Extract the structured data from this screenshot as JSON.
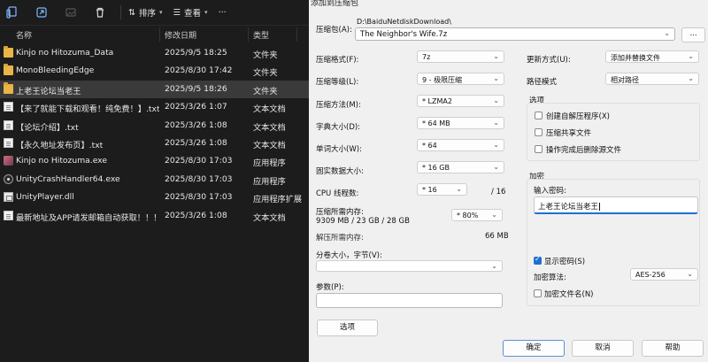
{
  "explorer": {
    "toolbar": {
      "sort_label": "排序",
      "view_label": "查看",
      "more_label": "···"
    },
    "columns": {
      "name": "名称",
      "date": "修改日期",
      "type": "类型"
    },
    "files": [
      {
        "name": "Kinjo no Hitozuma_Data",
        "date": "2025/9/5 18:25",
        "type": "文件夹",
        "icon": "folder-icon"
      },
      {
        "name": "MonoBleedingEdge",
        "date": "2025/8/30 17:42",
        "type": "文件夹",
        "icon": "folder-icon"
      },
      {
        "name": "上老王论坛当老王",
        "date": "2025/9/5 18:26",
        "type": "文件夹",
        "icon": "folder-icon"
      },
      {
        "name": "【来了就能下载和观看！纯免费！】.txt",
        "date": "2025/3/26 1:07",
        "type": "文本文档",
        "icon": "text-file-icon"
      },
      {
        "name": "【论坛介绍】.txt",
        "date": "2025/3/26 1:08",
        "type": "文本文档",
        "icon": "text-file-icon"
      },
      {
        "name": "【永久地址发布页】.txt",
        "date": "2025/3/26 1:08",
        "type": "文本文档",
        "icon": "text-file-icon"
      },
      {
        "name": "Kinjo no Hitozuma.exe",
        "date": "2025/8/30 17:03",
        "type": "应用程序",
        "icon": "app-icon"
      },
      {
        "name": "UnityCrashHandler64.exe",
        "date": "2025/8/30 17:03",
        "type": "应用程序",
        "icon": "unity-icon"
      },
      {
        "name": "UnityPlayer.dll",
        "date": "2025/8/30 17:03",
        "type": "应用程序扩展",
        "icon": "dll-icon"
      },
      {
        "name": "最新地址及APP请发邮箱自动获取！！！...",
        "date": "2025/3/26 1:08",
        "type": "文本文档",
        "icon": "text-file-icon"
      }
    ]
  },
  "dialog": {
    "title": "添加到压缩包",
    "archive_label": "压缩包(A):",
    "archive_path": "D:\\BaiduNetdiskDownload\\",
    "archive_name": "The Neighbor's Wife.7z",
    "browse_label": "...",
    "format_label": "压缩格式(F):",
    "format_value": "7z",
    "level_label": "压缩等级(L):",
    "level_value": "9 - 极限压缩",
    "method_label": "压缩方法(M):",
    "method_value": "* LZMA2",
    "dict_label": "字典大小(D):",
    "dict_value": "* 64 MB",
    "word_label": "单词大小(W):",
    "word_value": "* 64",
    "solid_label": "固实数据大小:",
    "solid_value": "* 16 GB",
    "threads_label": "CPU 线程数:",
    "threads_value": "* 16",
    "threads_total": "/ 16",
    "mem_comp_label": "压缩所需内存:",
    "mem_comp_value": "9309 MB / 23 GB / 28 GB",
    "mem_percent": "* 80%",
    "mem_decomp_label": "解压所需内存:",
    "mem_decomp_value": "66 MB",
    "split_label": "分卷大小，字节(V):",
    "params_label": "参数(P):",
    "options_button": "选项",
    "update_label": "更新方式(U):",
    "update_value": "添加并替换文件",
    "path_mode_label": "路径模式",
    "path_mode_value": "相对路径",
    "options_group": "选项",
    "opt_sfx": "创建自解压程序(X)",
    "opt_shared": "压缩共享文件",
    "opt_delete": "操作完成后删除源文件",
    "encrypt_group": "加密",
    "pw_label": "输入密码:",
    "pw_value": "上老王论坛当老王",
    "show_pw_label": "显示密码(S)",
    "enc_method_label": "加密算法:",
    "enc_method_value": "AES-256",
    "enc_names_label": "加密文件名(N)",
    "ok_button": "确定",
    "cancel_button": "取消",
    "help_button": "帮助"
  }
}
